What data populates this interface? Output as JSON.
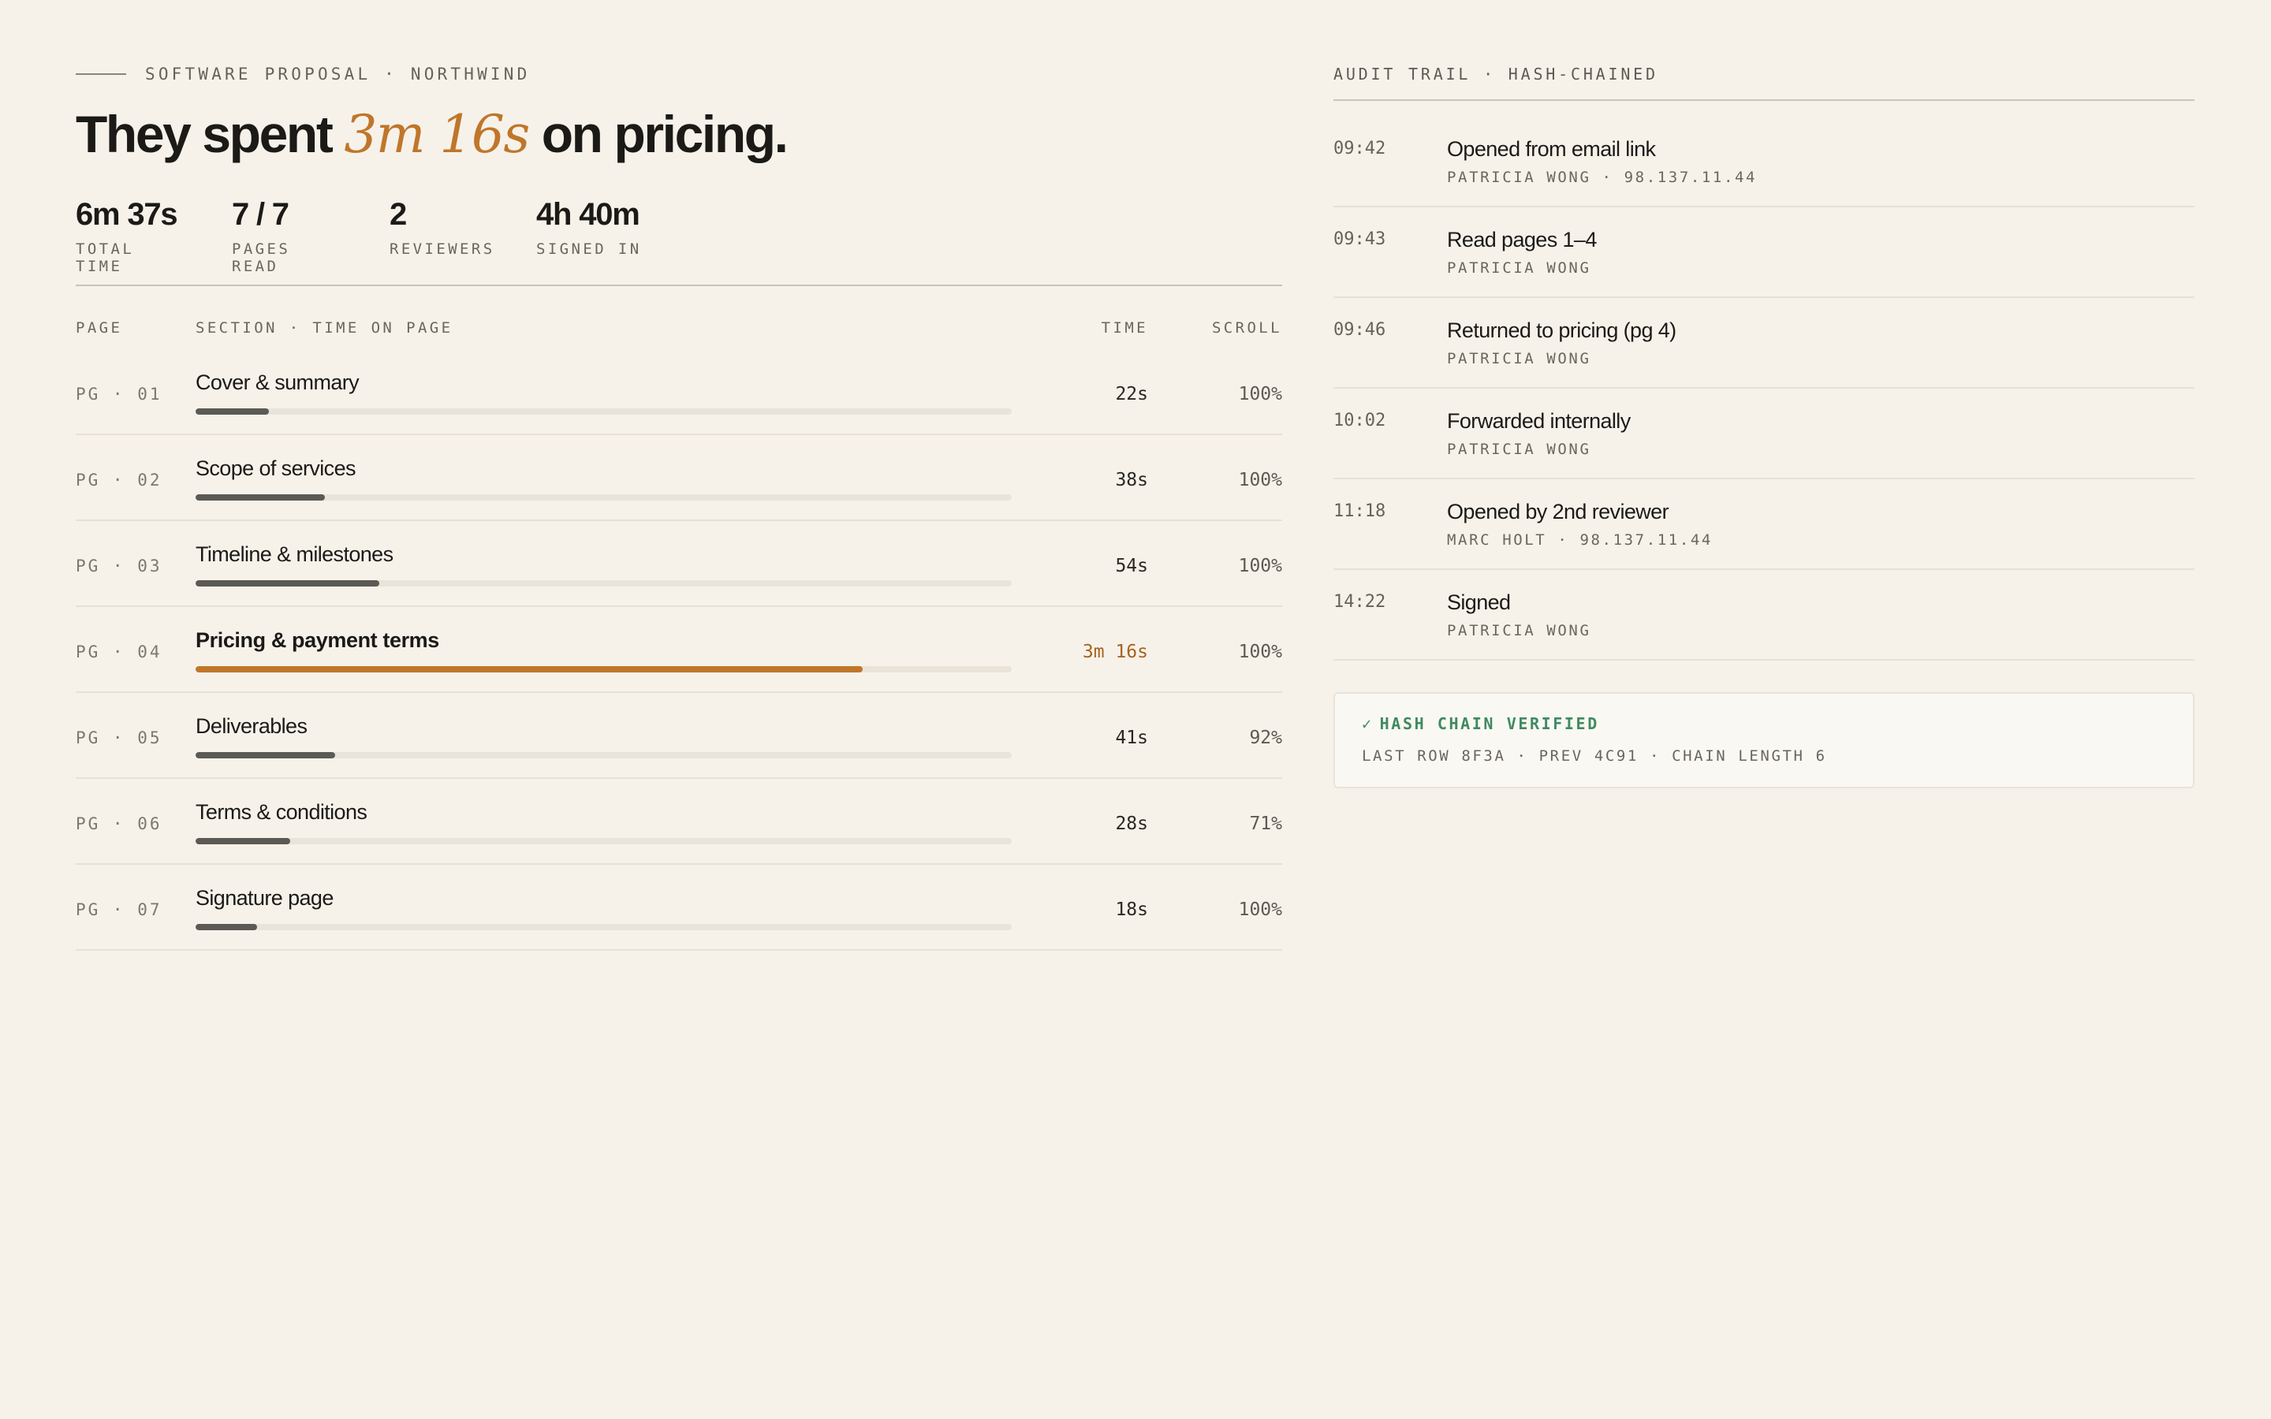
{
  "header": {
    "eyebrow": "Software proposal · Northwind",
    "headline_prefix": "They spent ",
    "headline_accent": "3m 16s",
    "headline_suffix": " on pricing."
  },
  "stats": [
    {
      "value": "6m 37s",
      "label": "Total time"
    },
    {
      "value": "7 / 7",
      "label": "Pages read"
    },
    {
      "value": "2",
      "label": "Reviewers"
    },
    {
      "value": "4h 40m",
      "label": "Signed in"
    }
  ],
  "table": {
    "headers": {
      "page": "Page",
      "section": "Section · time on page",
      "time": "Time",
      "scroll": "Scroll"
    },
    "rows": [
      {
        "page": "PG · 01",
        "section": "Cover & summary",
        "time": "22s",
        "scroll": "100%",
        "time_share": 0.09,
        "highlight": false
      },
      {
        "page": "PG · 02",
        "section": "Scope of services",
        "time": "38s",
        "scroll": "100%",
        "time_share": 0.158,
        "highlight": false
      },
      {
        "page": "PG · 03",
        "section": "Timeline & milestones",
        "time": "54s",
        "scroll": "100%",
        "time_share": 0.225,
        "highlight": false
      },
      {
        "page": "PG · 04",
        "section": "Pricing & payment terms",
        "time": "3m 16s",
        "scroll": "100%",
        "time_share": 0.817,
        "highlight": true
      },
      {
        "page": "PG · 05",
        "section": "Deliverables",
        "time": "41s",
        "scroll": "92%",
        "time_share": 0.171,
        "highlight": false
      },
      {
        "page": "PG · 06",
        "section": "Terms & conditions",
        "time": "28s",
        "scroll": "71%",
        "time_share": 0.116,
        "highlight": false
      },
      {
        "page": "PG · 07",
        "section": "Signature page",
        "time": "18s",
        "scroll": "100%",
        "time_share": 0.075,
        "highlight": false
      }
    ]
  },
  "audit": {
    "title": "Audit trail · hash-chained",
    "events": [
      {
        "time": "09:42",
        "title": "Opened from email link",
        "meta": "Patricia Wong · 98.137.11.44"
      },
      {
        "time": "09:43",
        "title": "Read pages 1–4",
        "meta": "Patricia Wong"
      },
      {
        "time": "09:46",
        "title": "Returned to pricing (pg 4)",
        "meta": "Patricia Wong"
      },
      {
        "time": "10:02",
        "title": "Forwarded internally",
        "meta": "Patricia Wong"
      },
      {
        "time": "11:18",
        "title": "Opened by 2nd reviewer",
        "meta": "Marc Holt · 98.137.11.44"
      },
      {
        "time": "14:22",
        "title": "Signed",
        "meta": "Patricia Wong"
      }
    ],
    "verify": {
      "check": "✓",
      "status": "Hash chain verified",
      "meta": "Last row 8F3A · prev 4C91 · chain length 6"
    }
  },
  "colors": {
    "background": "#f6f2ea",
    "accent": "#c0762a",
    "bar": "#5c5a55",
    "track": "#e9e4d9",
    "verified": "#3f8a62"
  }
}
